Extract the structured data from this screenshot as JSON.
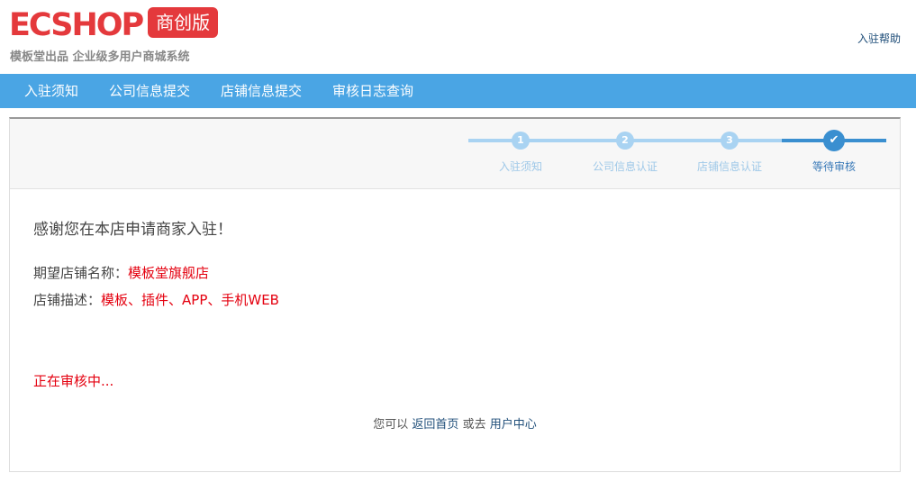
{
  "header": {
    "logo_word": "ECSHOP",
    "logo_badge": "商创版",
    "slogan": "模板堂出品  企业级多用户商城系统",
    "help_link": "入驻帮助"
  },
  "nav": {
    "items": [
      {
        "label": "入驻须知"
      },
      {
        "label": "公司信息提交"
      },
      {
        "label": "店铺信息提交"
      },
      {
        "label": "审核日志查询"
      }
    ]
  },
  "steps": [
    {
      "number": "1",
      "label": "入驻须知",
      "state": "done"
    },
    {
      "number": "2",
      "label": "公司信息认证",
      "state": "done"
    },
    {
      "number": "3",
      "label": "店铺信息认证",
      "state": "done"
    },
    {
      "number": "✔",
      "label": "等待审核",
      "state": "active"
    }
  ],
  "main": {
    "thanks": "感谢您在本店申请商家入驻！",
    "store_name_label": "期望店铺名称：",
    "store_name_value": "模板堂旗舰店",
    "store_desc_label": "店铺描述：",
    "store_desc_value": "模板、插件、APP、手机WEB",
    "status": "正在审核中...",
    "footer_prefix": "您可以",
    "home_link": "返回首页",
    "footer_or": "或去",
    "user_center_link": "用户中心"
  },
  "colors": {
    "brand_red": "#e4393c",
    "nav_blue": "#4aa5e4",
    "step_light": "#a9d3f2",
    "step_active": "#3a8fd0",
    "value_red": "#e4000f",
    "link_blue": "#1f4e79"
  }
}
